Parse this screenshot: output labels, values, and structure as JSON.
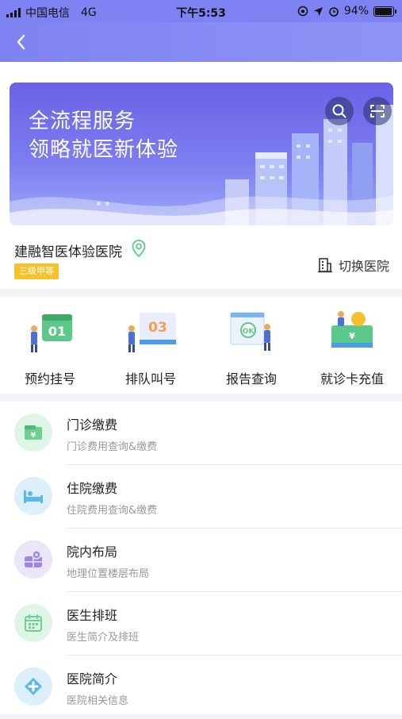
{
  "status_bar": {
    "carrier": "中国电信",
    "network": "4G",
    "time": "下午5:53",
    "battery": "94%",
    "battery_level": 0.94
  },
  "banner": {
    "line1": "全流程服务",
    "line2": "领略就医新体验"
  },
  "hospital": {
    "name": "建融智医体验医院",
    "level": "三级甲等",
    "switch_label": "切换医院"
  },
  "quick_actions": [
    {
      "label": "预约挂号",
      "badge": "01",
      "icon": "appointment-icon"
    },
    {
      "label": "排队叫号",
      "badge": "03",
      "icon": "queue-icon"
    },
    {
      "label": "报告查询",
      "badge": "OK",
      "icon": "report-icon"
    },
    {
      "label": "就诊卡充值",
      "badge": "¥",
      "icon": "card-recharge-icon"
    }
  ],
  "menu": [
    {
      "title": "门诊缴费",
      "subtitle": "门诊费用查询&缴费",
      "icon": "wallet-icon",
      "color": "#6fcf8f",
      "bg": "#dff5e7"
    },
    {
      "title": "住院缴费",
      "subtitle": "住院费用查询&缴费",
      "icon": "bed-icon",
      "color": "#5bb8e8",
      "bg": "#dcf0fb"
    },
    {
      "title": "院内布局",
      "subtitle": "地理位置楼层布局",
      "icon": "map-icon",
      "color": "#9a86e6",
      "bg": "#ebe5fa"
    },
    {
      "title": "医生排班",
      "subtitle": "医生简介及排班",
      "icon": "calendar-icon",
      "color": "#6fcf8f",
      "bg": "#dff5e7"
    },
    {
      "title": "医院简介",
      "subtitle": "医院相关信息",
      "icon": "hospital-info-icon",
      "color": "#5bb8e8",
      "bg": "#dcf0fb"
    }
  ],
  "colors": {
    "nav": "#7f82f2",
    "level_badge": "#f6c22c",
    "location_pin": "#5cc98a"
  }
}
